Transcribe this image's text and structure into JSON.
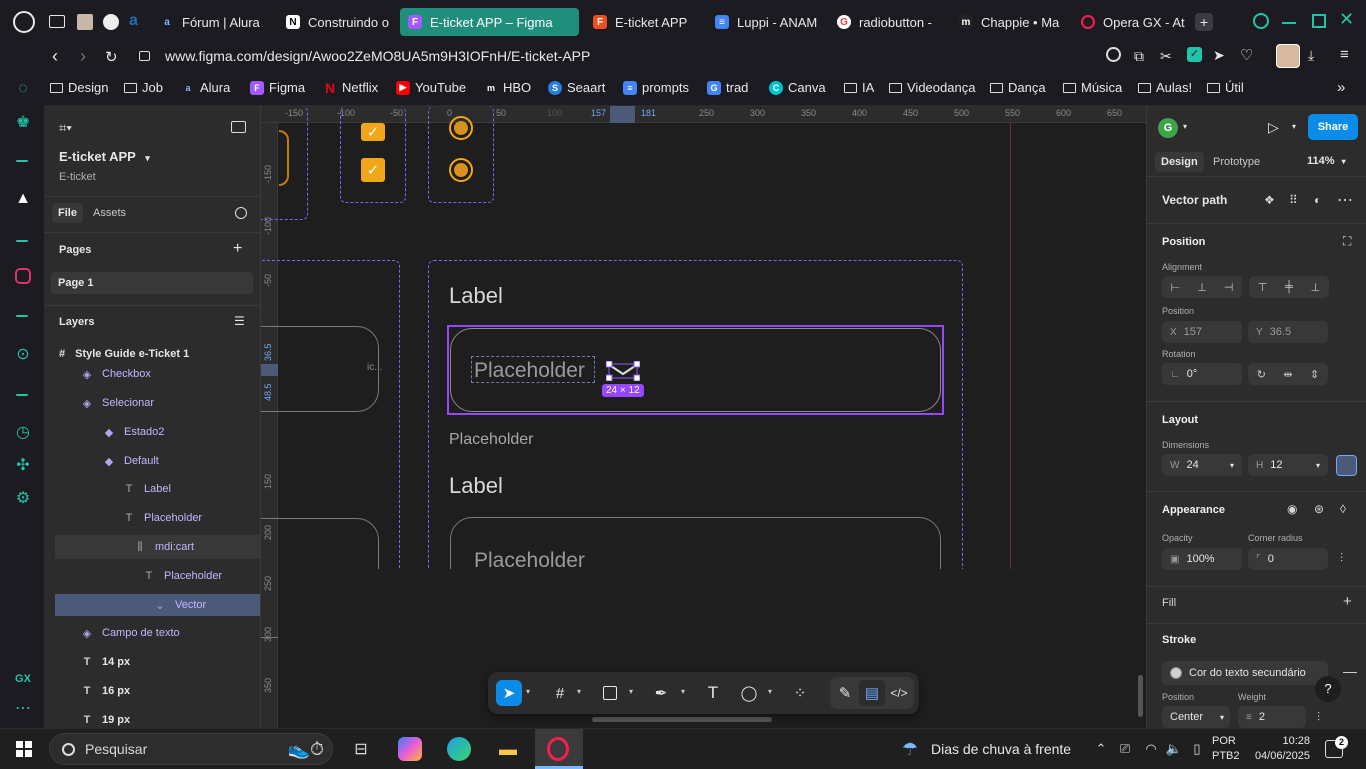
{
  "browser": {
    "tabs": [
      {
        "label": "Fórum | Alura",
        "fav": "a",
        "color": "#1c6fb6"
      },
      {
        "label": "Construindo o",
        "fav": "N",
        "color": "#ffffff"
      },
      {
        "label": "E-ticket APP – Figma",
        "fav": "F",
        "color": "#a259ff"
      },
      {
        "label": "E-ticket APP",
        "fav": "F",
        "color": "#f24e1e"
      },
      {
        "label": "Luppi - ANAM",
        "fav": "≡",
        "color": "#4285f4"
      },
      {
        "label": "radiobutton -",
        "fav": "G",
        "color": "#ea4335"
      },
      {
        "label": "Chappie • Ma",
        "fav": "m",
        "color": "#333333"
      },
      {
        "label": "Opera GX - At",
        "fav": "O",
        "color": "#fa1e4e"
      }
    ],
    "url": "www.figma.com/design/Awoo2ZeMO8UA5m9H3IOFnH/E-ticket-APP",
    "bookmarks": [
      "Design",
      "Job",
      "Alura",
      "Figma",
      "Netflix",
      "YouTube",
      "HBO",
      "Seaart",
      "prompts",
      "trad",
      "Canva",
      "IA",
      "Videodança",
      "Dança",
      "Música",
      "Aulas!",
      "Útil"
    ]
  },
  "left": {
    "file_title": "E-ticket APP",
    "file_sub": "E-ticket",
    "tab_file": "File",
    "tab_assets": "Assets",
    "pages_title": "Pages",
    "page1": "Page 1",
    "layers_title": "Layers",
    "frame": "Style Guide e-Ticket 1",
    "layers": [
      {
        "label": "Checkbox",
        "icon": "◈",
        "indent": 36,
        "purple": true
      },
      {
        "label": "Selecionar",
        "icon": "◈",
        "indent": 36,
        "purple": true
      },
      {
        "label": "Estado2",
        "icon": "◆",
        "indent": 60,
        "purple": false
      },
      {
        "label": "Default",
        "icon": "◆",
        "indent": 60,
        "purple": false
      },
      {
        "label": "Label",
        "icon": "T",
        "indent": 80,
        "purple": false
      },
      {
        "label": "Placeholder",
        "icon": "T",
        "indent": 80,
        "purple": false
      },
      {
        "label": "mdi:cart",
        "icon": "⫼",
        "indent": 80,
        "purple": false
      },
      {
        "label": "Placeholder",
        "icon": "T",
        "indent": 100,
        "purple": false
      },
      {
        "label": "Vector",
        "icon": "⌄",
        "indent": 100,
        "purple": false
      },
      {
        "label": "Campo de texto",
        "icon": "◈",
        "indent": 36,
        "purple": true
      },
      {
        "label": "14 px",
        "icon": "T",
        "indent": 16,
        "purple": false
      },
      {
        "label": "16 px",
        "icon": "T",
        "indent": 16,
        "purple": false
      },
      {
        "label": "19 px",
        "icon": "T",
        "indent": 16,
        "purple": false
      }
    ]
  },
  "canvas": {
    "ruler_top": [
      "-150",
      "-100",
      "-50",
      "0",
      "50",
      "100",
      "157",
      "181",
      "250",
      "300",
      "350",
      "400",
      "450",
      "500",
      "550",
      "600",
      "650"
    ],
    "ruler_left": [
      "-150",
      "-100",
      "-50",
      "36.5",
      "48.5",
      "150",
      "200",
      "250",
      "300",
      "350"
    ],
    "label1": "Label",
    "placeholder_in": "Placeholder",
    "size_badge": "24 × 12",
    "placeholder_out": "Placeholder",
    "label2": "Label",
    "placeholder2": "Placeholder",
    "left_ic": "ic..."
  },
  "right": {
    "avatar": "G",
    "share": "Share",
    "tab_design": "Design",
    "tab_prototype": "Prototype",
    "zoom": "114%",
    "layer_type": "Vector path",
    "position_title": "Position",
    "alignment": "Alignment",
    "position_sub": "Position",
    "x_label": "X",
    "x_value": "157",
    "y_label": "Y",
    "y_value": "36.5",
    "rotation": "Rotation",
    "rotation_value": "0°",
    "layout_title": "Layout",
    "dimensions": "Dimensions",
    "w_label": "W",
    "w_value": "24",
    "h_label": "H",
    "h_value": "12",
    "appearance_title": "Appearance",
    "opacity": "Opacity",
    "opacity_value": "100%",
    "corner_radius": "Corner radius",
    "corner_value": "0",
    "fill_title": "Fill",
    "stroke_title": "Stroke",
    "stroke_color_name": "Cor do texto secundário",
    "stroke_position": "Position",
    "stroke_weight": "Weight",
    "stroke_position_value": "Center",
    "stroke_weight_value": "2",
    "help": "?"
  },
  "taskbar": {
    "search": "Pesquisar",
    "weather": "Dias de chuva à frente",
    "lang1": "POR",
    "lang2": "PTB2",
    "time": "10:28",
    "date": "04/06/2025",
    "notif": "2"
  },
  "colors": {
    "accent_teal": "#1f8f7c",
    "figma_blue": "#0c8ce9",
    "component_purple": "#8a5cf5",
    "checkbox_orange": "#f2a719"
  }
}
